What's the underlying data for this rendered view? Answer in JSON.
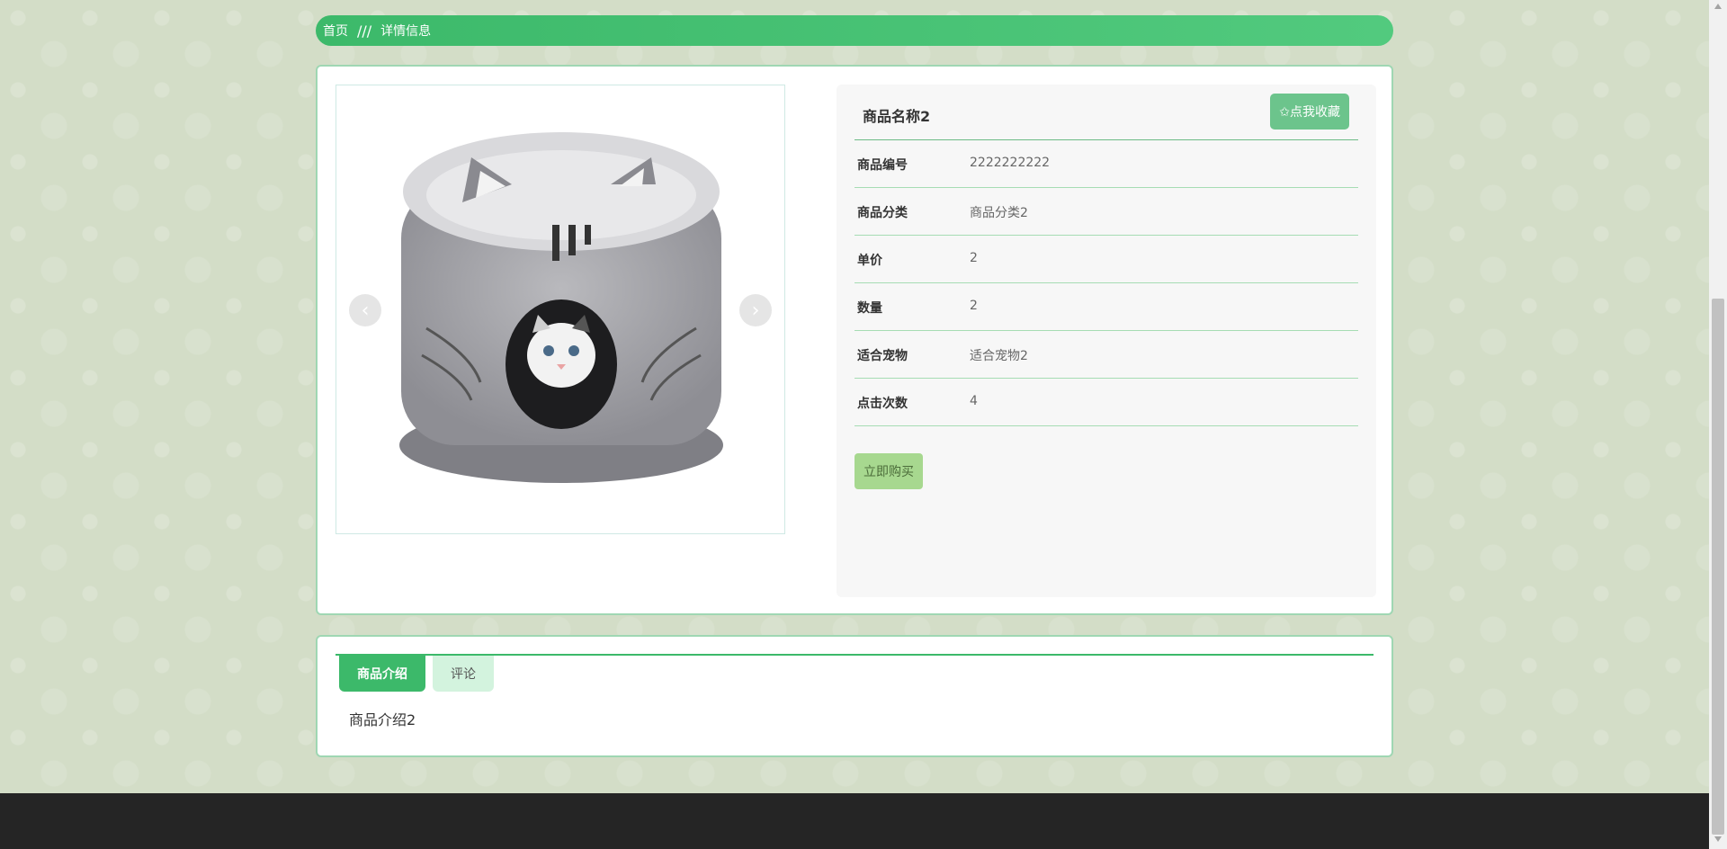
{
  "breadcrumb": {
    "home": "首页",
    "separator": "///",
    "current": "详情信息"
  },
  "product": {
    "name": "商品名称2",
    "favorite_label": "✩点我收藏",
    "buy_label": "立即购买",
    "fields": [
      {
        "label": "商品编号",
        "value": "2222222222"
      },
      {
        "label": "商品分类",
        "value": "商品分类2"
      },
      {
        "label": "单价",
        "value": "2"
      },
      {
        "label": "数量",
        "value": "2"
      },
      {
        "label": "适合宠物",
        "value": "适合宠物2"
      },
      {
        "label": "点击次数",
        "value": "4"
      }
    ]
  },
  "gallery": {
    "prev_icon": "‹",
    "next_icon": "›"
  },
  "tabs": {
    "intro": "商品介绍",
    "comments": "评论"
  },
  "intro_text": "商品介绍2",
  "colors": {
    "accent": "#3cb96a",
    "buy": "#a7d88f",
    "footer": "#252525"
  }
}
